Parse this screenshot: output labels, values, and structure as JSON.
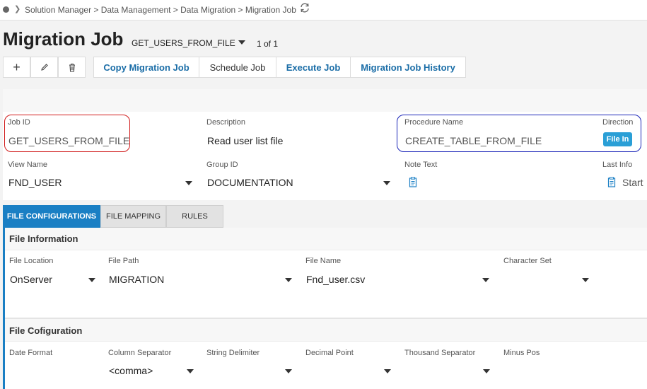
{
  "breadcrumb": {
    "path": "Solution Manager > Data Management > Data Migration > Migration Job"
  },
  "title": {
    "main": "Migration Job",
    "record": "GET_USERS_FROM_FILE",
    "count": "1 of 1"
  },
  "toolbar": {
    "copy_label": "Copy Migration Job",
    "schedule_label": "Schedule Job",
    "execute_label": "Execute Job",
    "history_label": "Migration Job History"
  },
  "header": {
    "job_id": {
      "label": "Job ID",
      "value": "GET_USERS_FROM_FILE"
    },
    "description": {
      "label": "Description",
      "value": "Read user list file"
    },
    "procedure_name": {
      "label": "Procedure Name",
      "value": "CREATE_TABLE_FROM_FILE"
    },
    "direction": {
      "label": "Direction",
      "value": "File In"
    },
    "view_name": {
      "label": "View Name",
      "value": "FND_USER"
    },
    "group_id": {
      "label": "Group ID",
      "value": "DOCUMENTATION"
    },
    "note_text": {
      "label": "Note Text"
    },
    "last_info": {
      "label": "Last Info",
      "value": "Start"
    }
  },
  "tabs": [
    {
      "label": "FILE CONFIGURATIONS",
      "active": true
    },
    {
      "label": "FILE MAPPING",
      "active": false
    },
    {
      "label": "RULES",
      "active": false
    }
  ],
  "file_information": {
    "heading": "File Information",
    "file_location": {
      "label": "File Location",
      "value": "OnServer"
    },
    "file_path": {
      "label": "File Path",
      "value": "MIGRATION"
    },
    "file_name": {
      "label": "File Name",
      "value": "Fnd_user.csv"
    },
    "character_set": {
      "label": "Character Set",
      "value": ""
    }
  },
  "file_configuration": {
    "heading": "File Cofiguration",
    "date_format": {
      "label": "Date Format"
    },
    "column_separator": {
      "label": "Column Separator",
      "value": "<comma>"
    },
    "string_delimiter": {
      "label": "String Delimiter",
      "value": ""
    },
    "decimal_point": {
      "label": "Decimal Point",
      "value": ""
    },
    "thousand_separator": {
      "label": "Thousand Separator",
      "value": ""
    },
    "minus_pos": {
      "label": "Minus Pos"
    }
  },
  "colors": {
    "accent": "#1a7fc4",
    "link": "#1a6da7",
    "highlight_red": "#d01a1a",
    "highlight_blue": "#1a24b8",
    "badge": "#2a9fd6"
  }
}
